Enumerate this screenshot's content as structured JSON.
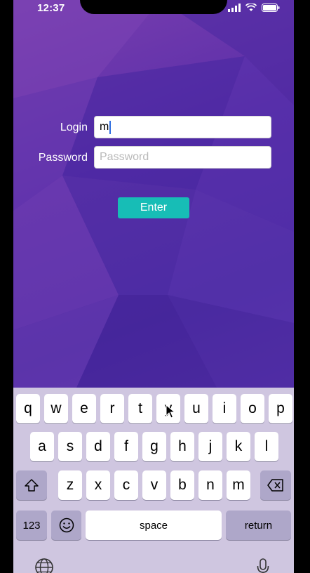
{
  "status_bar": {
    "time": "12:37",
    "icons": [
      "signal-icon",
      "wifi-icon",
      "battery-icon"
    ]
  },
  "form": {
    "login_label": "Login",
    "login_value": "m",
    "password_label": "Password",
    "password_placeholder": "Password",
    "enter_button": "Enter"
  },
  "keyboard": {
    "row1": [
      "q",
      "w",
      "e",
      "r",
      "t",
      "y",
      "u",
      "i",
      "o",
      "p"
    ],
    "row2": [
      "a",
      "s",
      "d",
      "f",
      "g",
      "h",
      "j",
      "k",
      "l"
    ],
    "row3": [
      "z",
      "x",
      "c",
      "v",
      "b",
      "n",
      "m"
    ],
    "numbers_key": "123",
    "space_key": "space",
    "return_key": "return",
    "icons": [
      "shift-icon",
      "backspace-icon",
      "emoji-icon",
      "globe-icon",
      "microphone-icon"
    ]
  },
  "colors": {
    "background": "#5a2ea8",
    "enter_button": "#17bdb6",
    "keyboard": "#cfc6e0",
    "caret": "#2d6cdf"
  }
}
